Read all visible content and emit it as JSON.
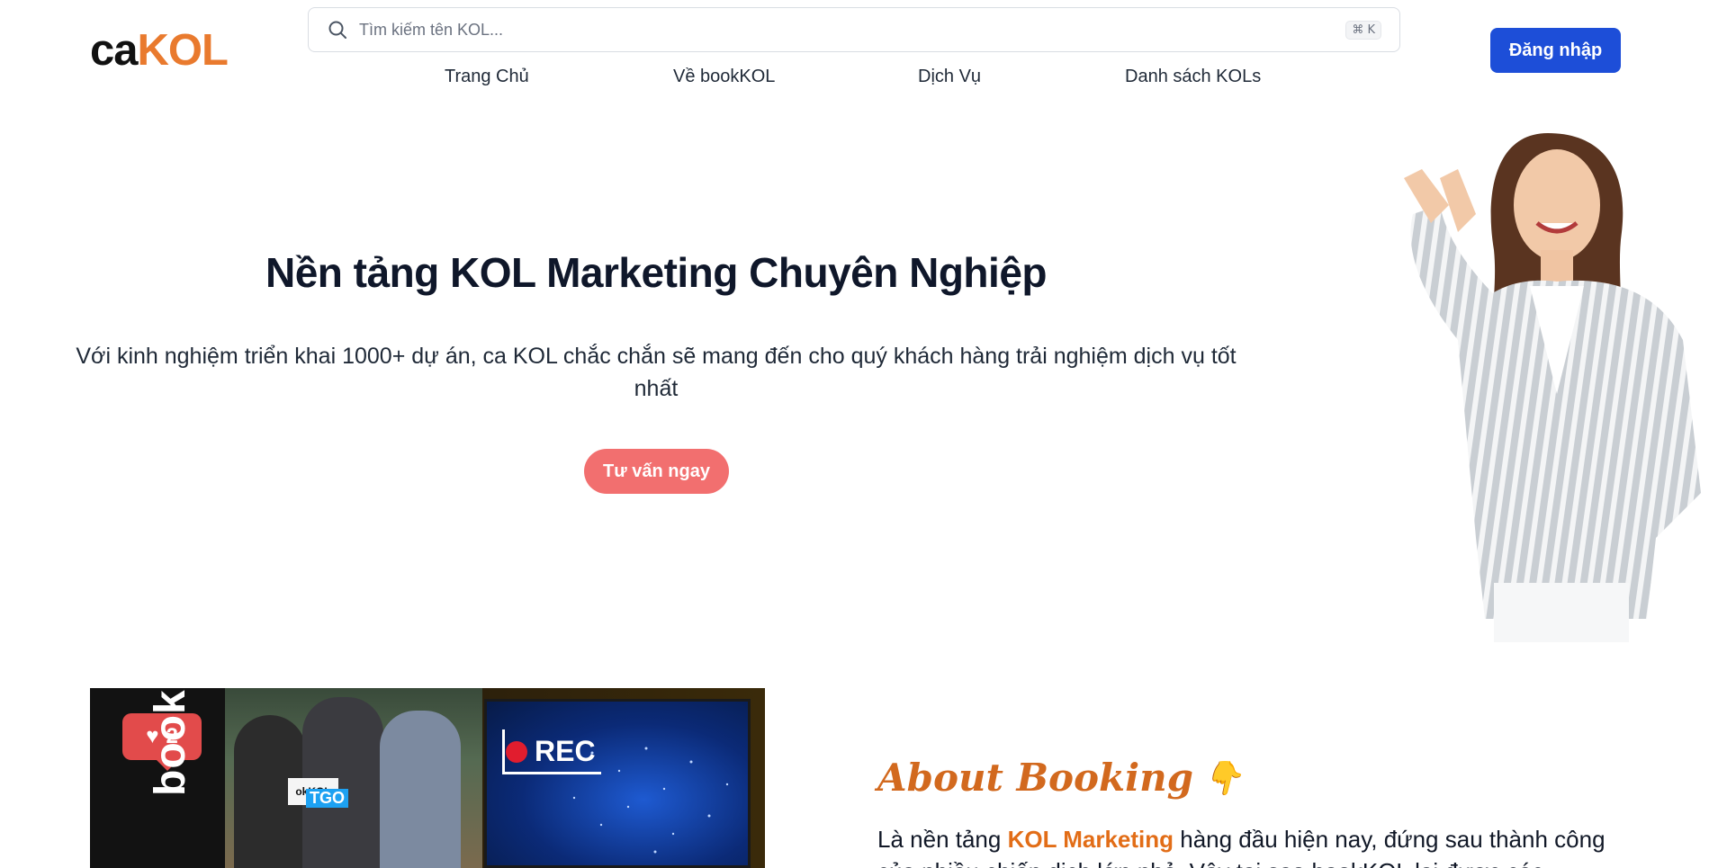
{
  "header": {
    "logo_ca": "ca",
    "logo_kol": "KOL",
    "search": {
      "placeholder": "Tìm kiếm tên KOL...",
      "shortcut": "⌘ K",
      "icon": "search-icon"
    },
    "nav": [
      {
        "label": "Trang Chủ"
      },
      {
        "label": "Về bookKOL"
      },
      {
        "label": "Dịch Vụ"
      },
      {
        "label": "Danh sách KOLs"
      }
    ],
    "login_label": "Đăng nhập"
  },
  "hero": {
    "title": "Nền tảng KOL Marketing Chuyên Nghiệp",
    "subtitle": "Với kinh nghiệm triển khai 1000+ dự án, ca KOL chắc chắn sẽ mang đến cho quý khách hàng trải nghiệm dịch vụ tốt nhất",
    "cta_label": "Tư vấn ngay"
  },
  "media": {
    "like_count": "2",
    "brand_text": "bookKOL",
    "logo_card": "okKOL",
    "tgo": "TGO",
    "rec": "REC"
  },
  "about": {
    "title": "About Booking",
    "hand_icon": "pointing-hand-icon",
    "text_before": "Là nền tảng ",
    "text_highlight": "KOL Marketing",
    "text_after": " hàng đầu hiện nay, đứng sau thành công của nhiều chiến dịch lớn nhỏ. Vậy tại sao bookKOL lại được các"
  },
  "colors": {
    "brand_orange": "#e97a2e",
    "login_blue": "#1d4ed8",
    "cta_coral": "#f26f6f"
  }
}
